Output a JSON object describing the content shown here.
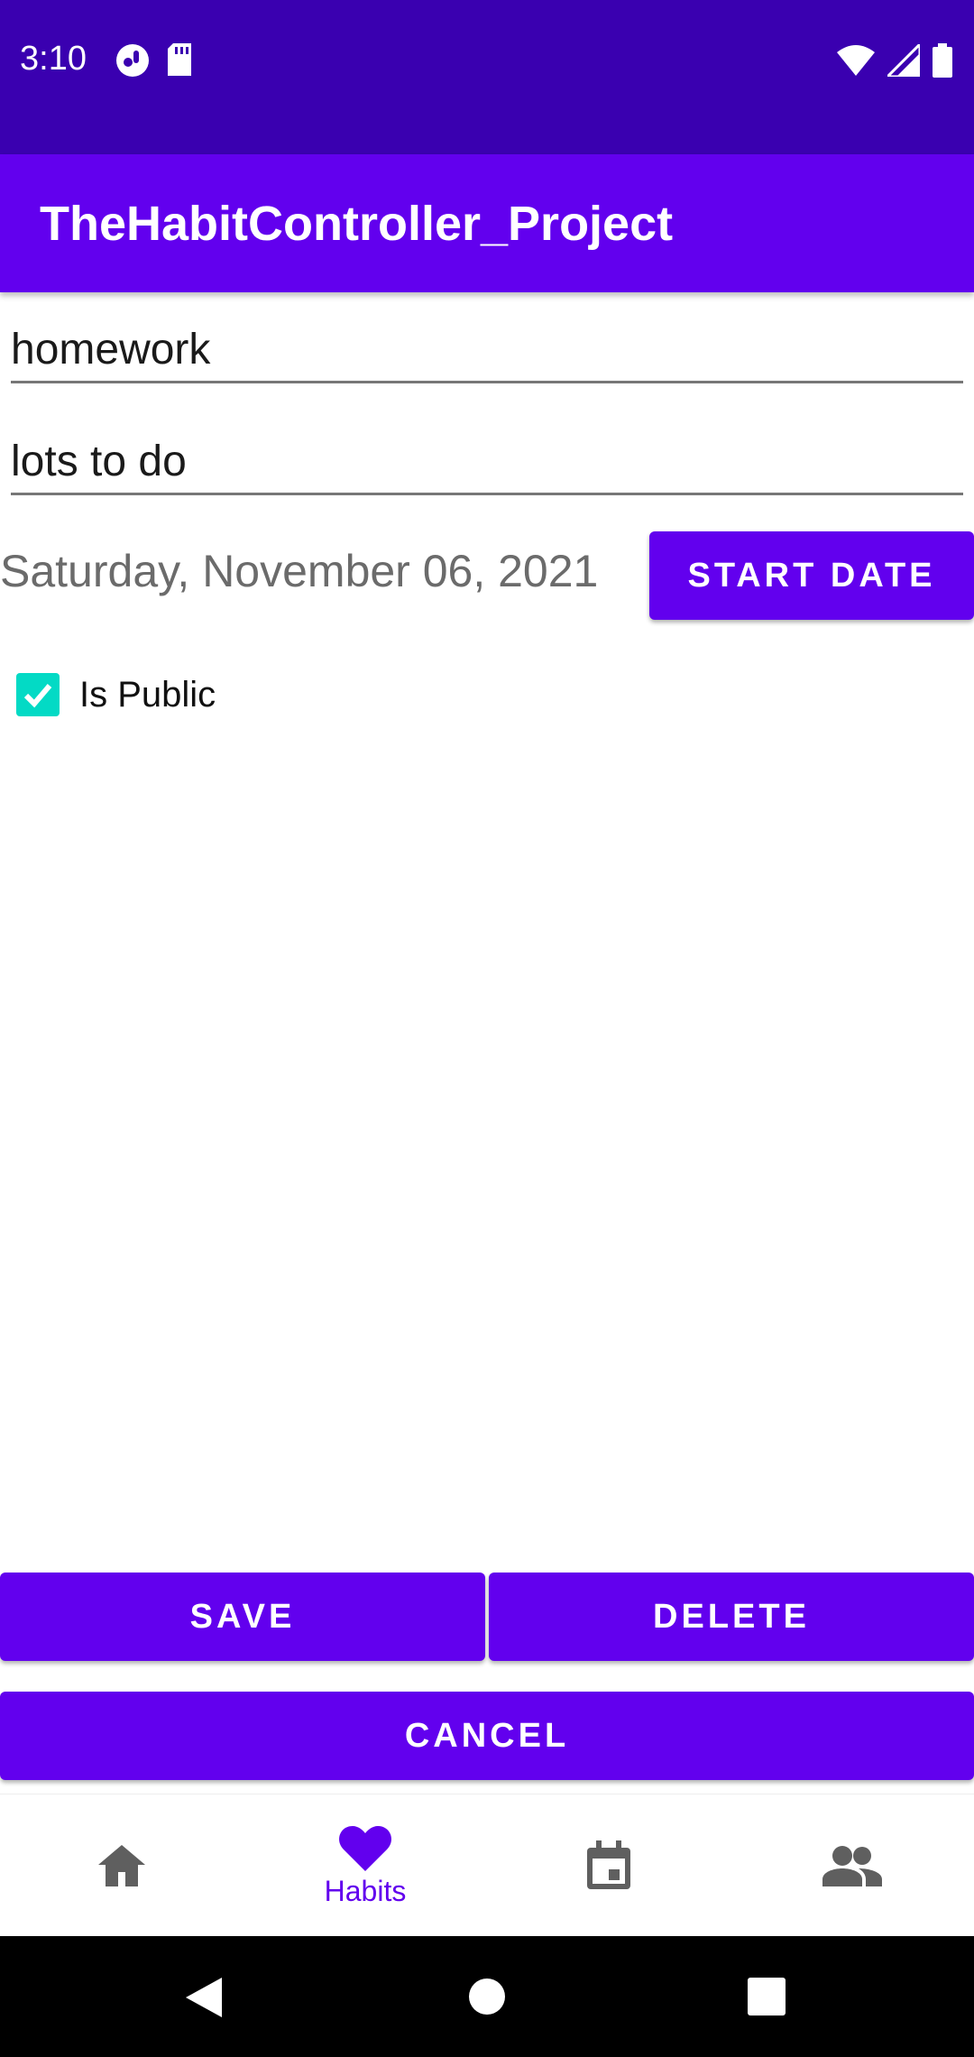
{
  "status_bar": {
    "time": "3:10",
    "left_icons": [
      "app-notification-icon",
      "sd-card-icon"
    ],
    "right_icons": [
      "wifi-icon",
      "signal-icon",
      "battery-icon"
    ]
  },
  "app_bar": {
    "title": "TheHabitController_Project"
  },
  "form": {
    "title_value": "homework",
    "reason_value": "lots to do",
    "date_text": "Saturday, November 06, 2021",
    "start_date_label": "START DATE",
    "is_public_label": "Is Public",
    "is_public_checked": true
  },
  "actions": {
    "save": "SAVE",
    "delete": "DELETE",
    "cancel": "CANCEL"
  },
  "bottom_nav": {
    "items": [
      {
        "icon": "home-icon",
        "label": ""
      },
      {
        "icon": "heart-icon",
        "label": "Habits",
        "active": true
      },
      {
        "icon": "calendar-icon",
        "label": ""
      },
      {
        "icon": "people-icon",
        "label": ""
      }
    ]
  },
  "system_nav": [
    "back-icon",
    "home-circle-icon",
    "recents-icon"
  ],
  "colors": {
    "primary": "#6200ee",
    "primary_dark": "#3a00b0",
    "accent": "#03dac5"
  }
}
